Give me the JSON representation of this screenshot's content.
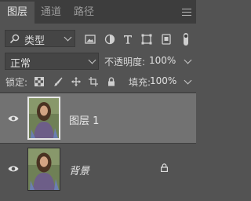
{
  "tabs": [
    {
      "label": "图层",
      "active": true
    },
    {
      "label": "通道",
      "active": false
    },
    {
      "label": "路径",
      "active": false
    }
  ],
  "filter": {
    "kind_label": "类型",
    "icons": [
      "image-filter-icon",
      "adjustment-filter-icon",
      "type-filter-icon",
      "shape-filter-icon",
      "smart-object-filter-icon",
      "filter-toggle-icon"
    ]
  },
  "blend": {
    "mode": "正常",
    "opacity_label": "不透明度:",
    "opacity_value": "100%"
  },
  "lock": {
    "label": "锁定:",
    "icons": [
      "lock-transparent-pixels-icon",
      "lock-image-pixels-icon",
      "lock-position-icon",
      "lock-artboard-icon",
      "lock-all-icon"
    ],
    "fill_label": "填充:",
    "fill_value": "100%"
  },
  "layers": [
    {
      "name": "图层 1",
      "selected": true,
      "visible": true,
      "locked": false
    },
    {
      "name": "背景",
      "selected": false,
      "visible": true,
      "locked": true
    }
  ],
  "colors": {
    "panel_bg": "#535353",
    "tabbar_bg": "#3d3d3d",
    "selected_row": "#727272"
  }
}
